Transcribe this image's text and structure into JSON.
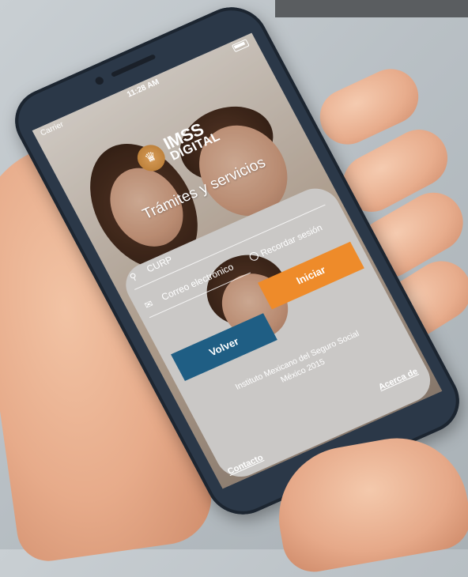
{
  "status_bar": {
    "carrier": "Carrier",
    "time": "11:28 AM"
  },
  "logo": {
    "line1": "IMSS",
    "line2": "DIGITAL"
  },
  "tagline": "Trámites y servicios",
  "form": {
    "curp_placeholder": "CURP",
    "email_placeholder": "Correo electrónico",
    "remember_label": "Recordar sesión",
    "start_label": "Iniciar",
    "back_label": "Volver"
  },
  "footer": {
    "line1": "Instituto Mexicano del Seguro Social",
    "line2": "México 2015"
  },
  "links": {
    "about": "Acerca de",
    "contact": "Contacto"
  },
  "colors": {
    "start_button": "#ee8b2a",
    "back_button": "#1f5e84",
    "phone_frame": "#2b3848"
  }
}
